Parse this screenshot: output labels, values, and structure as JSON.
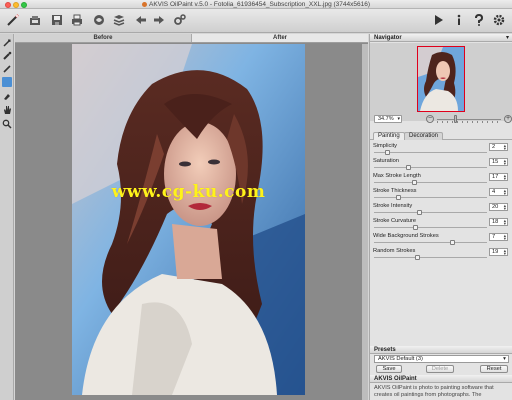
{
  "window": {
    "title": "AKVIS OilPaint v.5.0 - Fotolia_61936454_Subscription_XXL.jpg (3744x5616)"
  },
  "toolbar": {
    "left_icons": [
      "magic-wand-icon",
      "open-image-icon",
      "save-image-icon",
      "print-icon",
      "share-icon",
      "batch-icon",
      "undo-icon",
      "redo-icon",
      "run-processing-icon"
    ],
    "right_icons": [
      "akvis-logo-icon",
      "info-icon",
      "help-icon",
      "preferences-icon"
    ]
  },
  "left_tools": [
    "direction-icon",
    "brush-icon",
    "pencil-icon",
    "color-swatch",
    "eraser-icon",
    "hand-icon",
    "zoom-icon"
  ],
  "canvas": {
    "tab_before": "Before",
    "tab_after": "After",
    "watermark": "www.cg-ku.com"
  },
  "navigator": {
    "title": "Navigator",
    "zoom": "34.7%",
    "zoom_minus": "−",
    "zoom_plus": "+"
  },
  "params": {
    "tab_painting": "Painting",
    "tab_decoration": "Decoration",
    "items": [
      {
        "label": "Simplicity",
        "value": "2",
        "level": 0.1
      },
      {
        "label": "Saturation",
        "value": "15",
        "level": 0.3
      },
      {
        "label": "Max Stroke Length",
        "value": "17",
        "level": 0.35
      },
      {
        "label": "Stroke Thickness",
        "value": "4",
        "level": 0.2
      },
      {
        "label": "Stroke Intensity",
        "value": "20",
        "level": 0.4
      },
      {
        "label": "Stroke Curvature",
        "value": "18",
        "level": 0.36
      },
      {
        "label": "Wide Background Strokes",
        "value": "7",
        "level": 0.7
      },
      {
        "label": "Random Strokes",
        "value": "19",
        "level": 0.38
      }
    ]
  },
  "presets": {
    "title": "Presets",
    "selected": "AKVIS Default (3)",
    "save": "Save",
    "delete": "Delete",
    "reset": "Reset"
  },
  "about": {
    "title": "AKVIS OilPaint",
    "text": "AKVIS OilPaint is photo to painting software that creates oil paintings from photographs. The"
  },
  "colors": {
    "accent": "#4b8fd4",
    "watermark": "#fff31a",
    "nav_frame": "#e0001b"
  }
}
